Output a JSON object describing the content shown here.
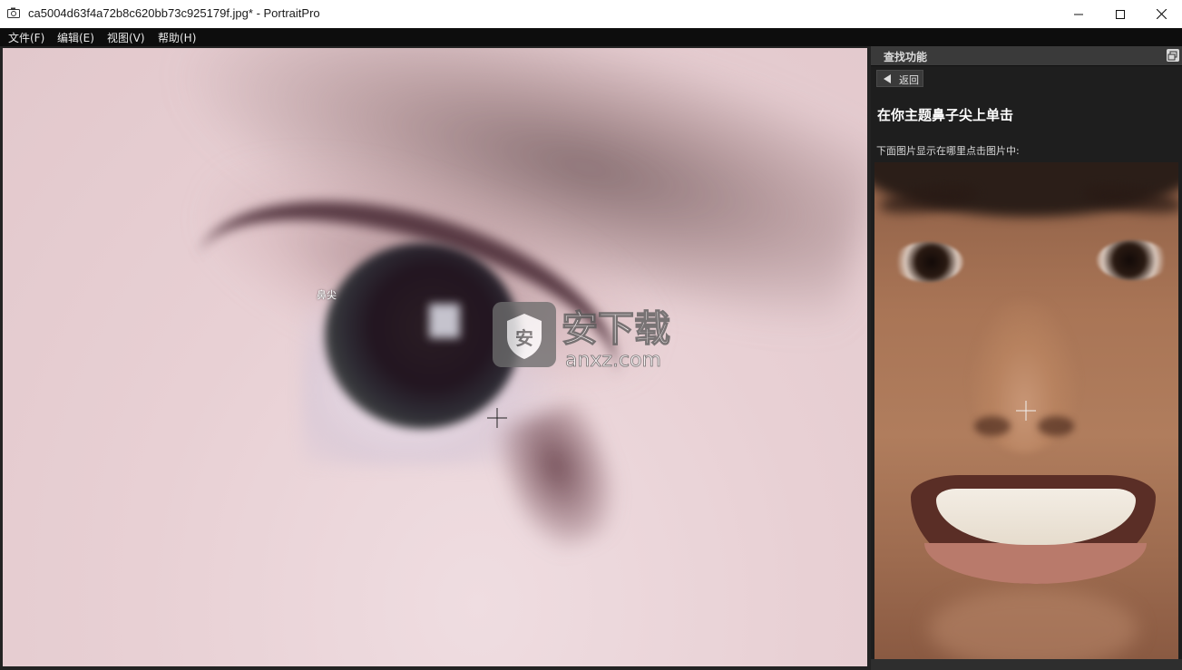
{
  "window": {
    "title": "ca5004d63f4a72b8c620bb73c925179f.jpg* - PortraitPro",
    "icon": "camera-icon",
    "controls": [
      "minimize-icon",
      "maximize-icon",
      "close-icon"
    ]
  },
  "menu": {
    "items": [
      {
        "label": "文件(F)"
      },
      {
        "label": "编辑(E)"
      },
      {
        "label": "视图(V)"
      },
      {
        "label": "帮助(H)"
      }
    ]
  },
  "canvas": {
    "marker_label": "鼻尖",
    "watermark": {
      "text_cn": "安下载",
      "text_en": "anxz.com",
      "icon": "shield-icon"
    }
  },
  "panel": {
    "title": "查找功能",
    "back_label": "返回",
    "instruction": "在你主题鼻子尖上单击",
    "subtext": "下面图片显示在哪里点击图片中:"
  },
  "colors": {
    "menubar_bg": "#0d0d0d",
    "panel_bg": "#1e1e1e",
    "panel_header_bg": "#3a3a3a"
  }
}
